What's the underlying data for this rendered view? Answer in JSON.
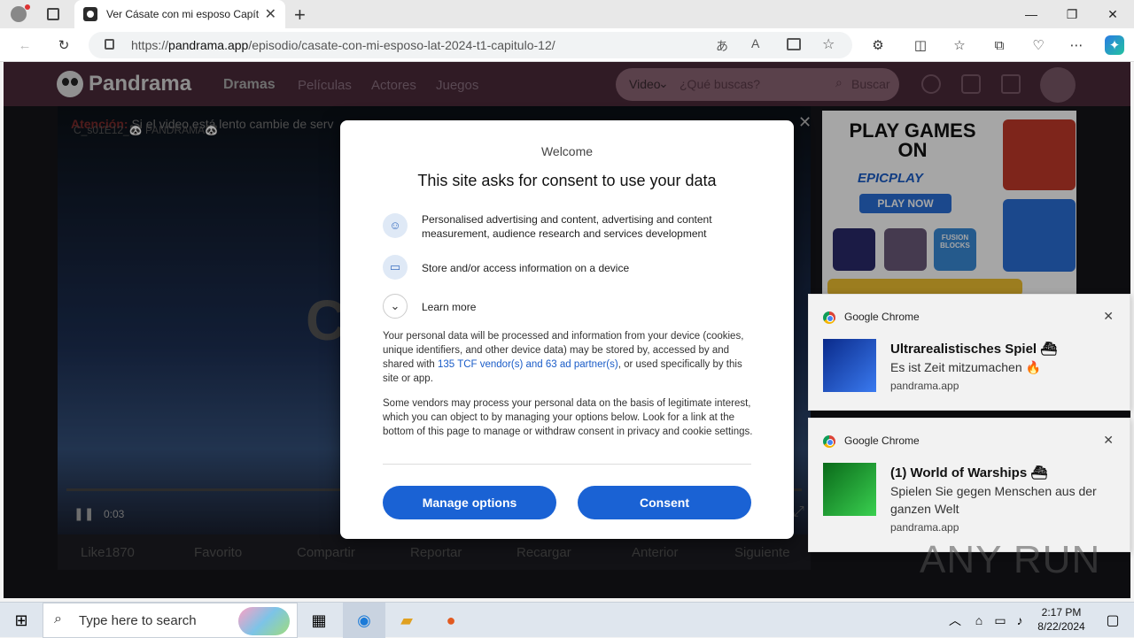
{
  "browser": {
    "tab_title": "Ver Cásate con mi esposo Capítul",
    "url_scheme": "https://",
    "url_host": "pandrama.app",
    "url_path": "/episodio/casate-con-mi-esposo-lat-2024-t1-capitulo-12/"
  },
  "site": {
    "logo": "Pandrama",
    "nav": [
      "Dramas",
      "Películas",
      "Actores",
      "Juegos"
    ],
    "search_type": "Video",
    "search_placeholder": "¿Qué buscas?",
    "search_button": "Buscar",
    "attention_label": "Atención:",
    "attention_text": "Si el video está lento cambie de serv",
    "episode_tag": "C_s01E12_🐼 PANDRAMA🐼",
    "player_time": "0:03",
    "actions": [
      "Like1870",
      "Favorito",
      "Compartir",
      "Reportar",
      "Recargar",
      "Anterior",
      "Siguiente"
    ]
  },
  "ad": {
    "headline": "PLAY GAMES ON",
    "brand": "EPICPLAY",
    "cta": "PLAY NOW",
    "tile_label": "FUSION BLOCKS"
  },
  "consent": {
    "welcome": "Welcome",
    "title": "This site asks for consent to use your data",
    "purpose1": "Personalised advertising and content, advertising and content measurement, audience research and services development",
    "purpose2": "Store and/or access information on a device",
    "learn_more": "Learn more",
    "para1_a": "Your personal data will be processed and information from your device (cookies, unique identifiers, and other device data) may be stored by, accessed by and shared with ",
    "para1_link": "135 TCF vendor(s) and 63 ad partner(s)",
    "para1_b": ", or used specifically by this site or app.",
    "para2": "Some vendors may process your personal data on the basis of legitimate interest, which you can object to by managing your options below. Look for a link at the bottom of this page to manage or withdraw consent in privacy and cookie settings.",
    "manage_button": "Manage options",
    "consent_button": "Consent"
  },
  "notifications": [
    {
      "app": "Google Chrome",
      "title": "Ultrarealistisches Spiel ⛴",
      "body": "Es ist Zeit mitzumachen 🔥",
      "source": "pandrama.app"
    },
    {
      "app": "Google Chrome",
      "title": "(1) World of Warships ⛴",
      "body": "Spielen Sie gegen Menschen aus der ganzen Welt",
      "source": "pandrama.app"
    }
  ],
  "watermark": "ANY RUN",
  "taskbar": {
    "search_placeholder": "Type here to search",
    "time": "2:17 PM",
    "date": "8/22/2024"
  }
}
